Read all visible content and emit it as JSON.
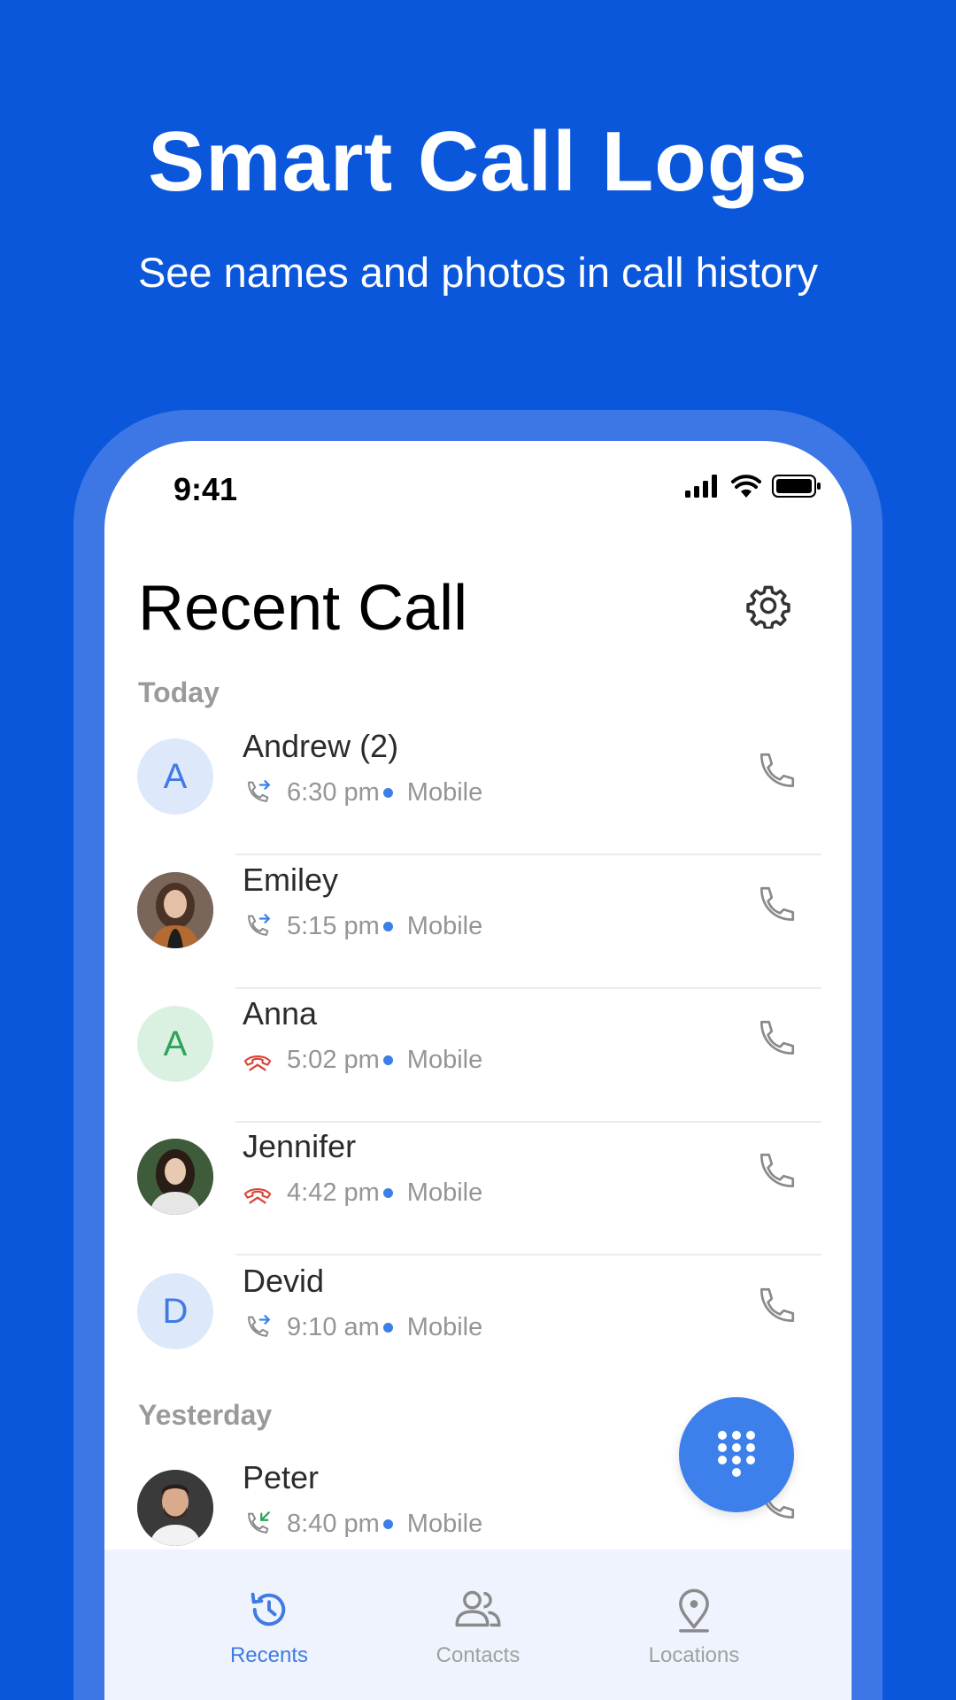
{
  "hero": {
    "title": "Smart Call Logs",
    "subtitle": "See names and photos in call history"
  },
  "status_bar": {
    "time": "9:41",
    "icons": [
      "signal-icon",
      "wifi-icon",
      "battery-icon"
    ]
  },
  "page": {
    "title": "Recent Call",
    "settings_icon": "gear-icon"
  },
  "sections": {
    "today": "Today",
    "yesterday": "Yesterday"
  },
  "calls": [
    {
      "name": "Andrew (2)",
      "initial": "A",
      "avatar": "initial-blue",
      "type": "outgoing",
      "time": "6:30 pm",
      "label": "Mobile"
    },
    {
      "name": "Emiley",
      "initial": "",
      "avatar": "photo",
      "type": "outgoing",
      "time": "5:15 pm",
      "label": "Mobile"
    },
    {
      "name": "Anna",
      "initial": "A",
      "avatar": "initial-green",
      "type": "missed",
      "time": "5:02 pm",
      "label": "Mobile"
    },
    {
      "name": "Jennifer",
      "initial": "",
      "avatar": "photo",
      "type": "missed",
      "time": "4:42 pm",
      "label": "Mobile"
    },
    {
      "name": "Devid",
      "initial": "D",
      "avatar": "initial-blue",
      "type": "outgoing",
      "time": "9:10 am",
      "label": "Mobile"
    },
    {
      "name": "Peter",
      "initial": "",
      "avatar": "photo",
      "type": "incoming",
      "time": "8:40 pm",
      "label": "Mobile"
    }
  ],
  "fab": {
    "icon": "dialpad-icon"
  },
  "nav": [
    {
      "label": "Recents",
      "icon": "history-icon",
      "active": true
    },
    {
      "label": "Contacts",
      "icon": "contacts-icon",
      "active": false
    },
    {
      "label": "Locations",
      "icon": "location-pin-icon",
      "active": false
    }
  ],
  "colors": {
    "background": "#0b57db",
    "frame": "#3d77e6",
    "accent": "#3d80ec",
    "missed": "#d9453a",
    "incoming": "#2ea35a"
  }
}
